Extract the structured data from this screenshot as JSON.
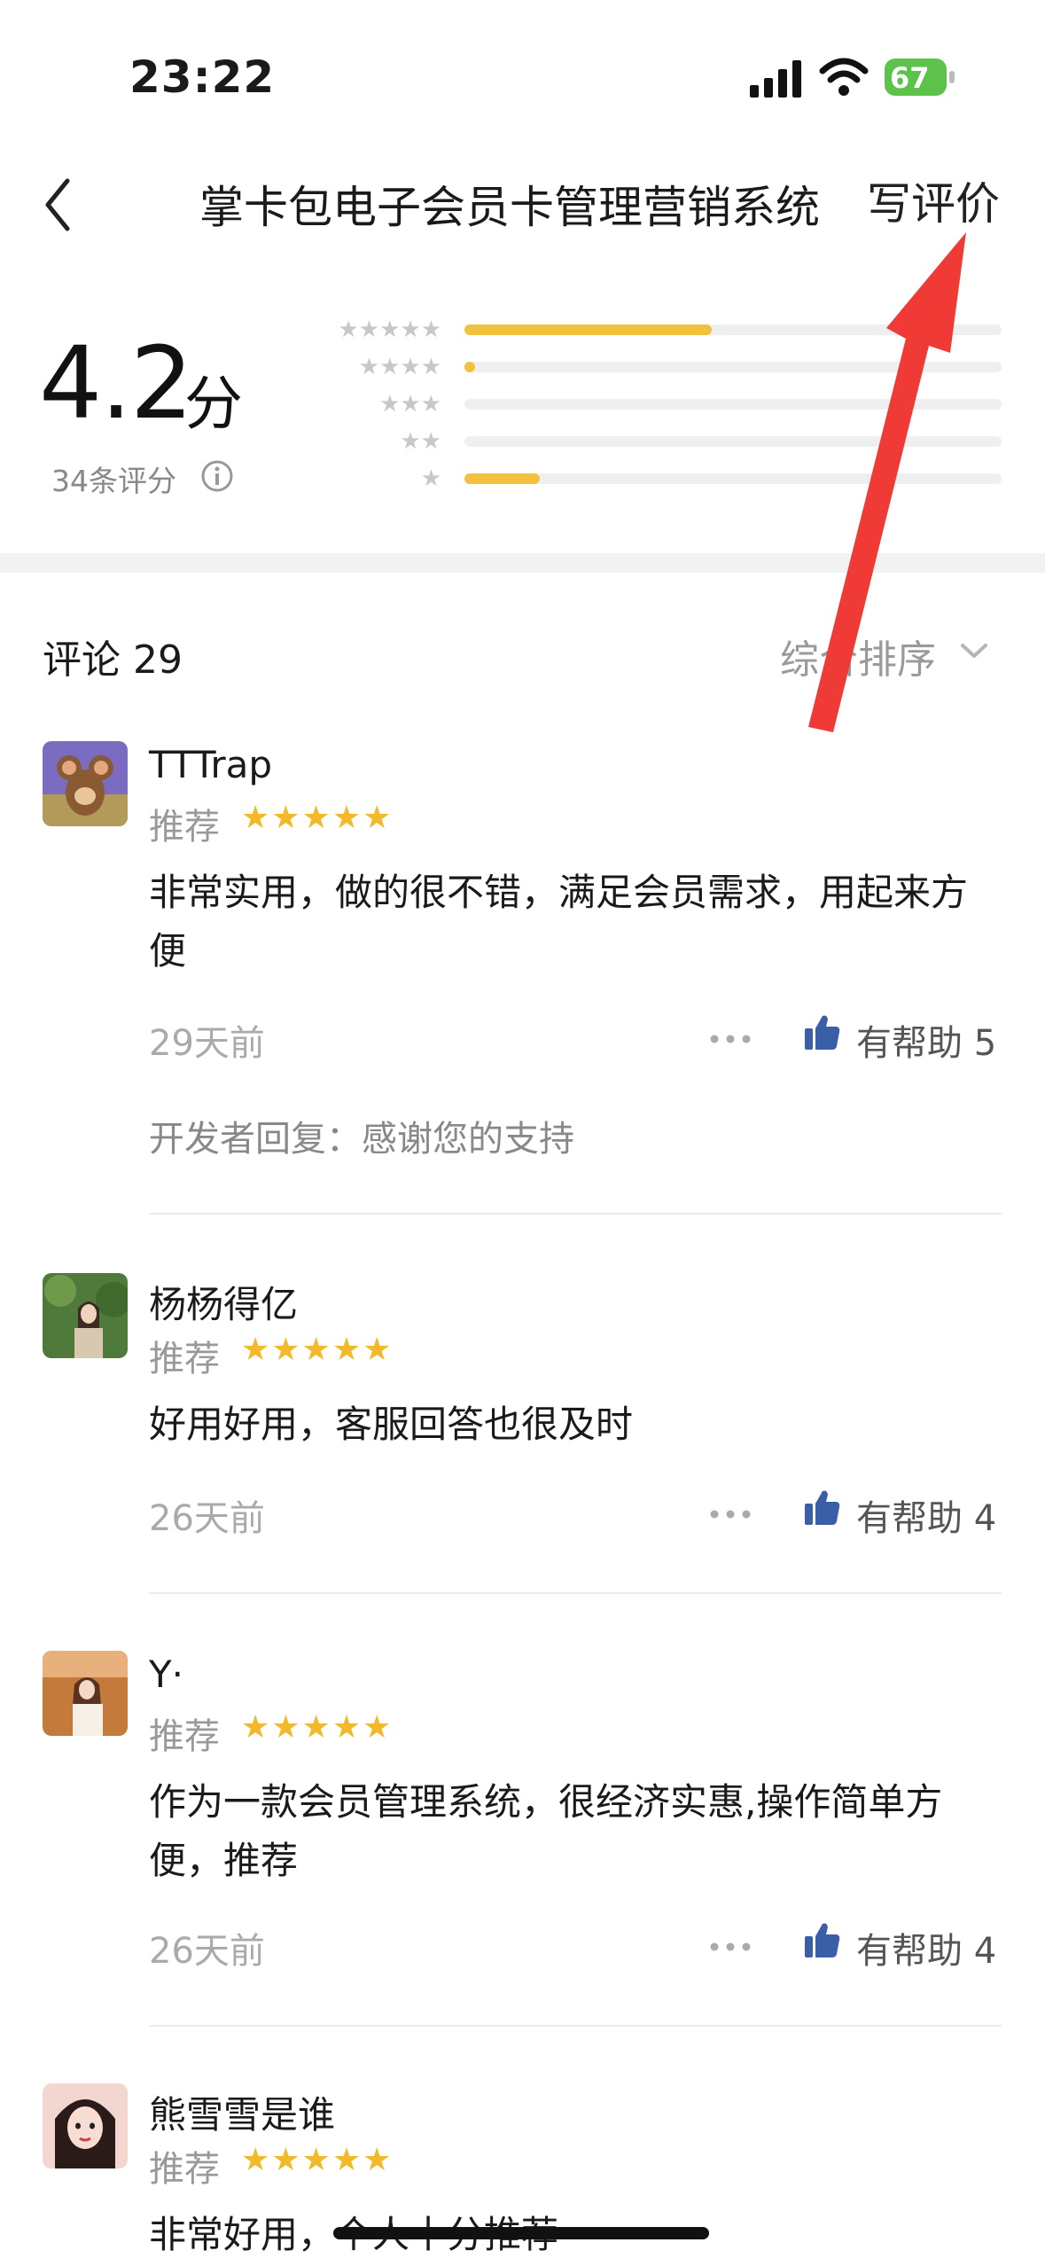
{
  "status_bar": {
    "time": "23:22",
    "battery": "67"
  },
  "nav": {
    "title": "掌卡包电子会员卡管理营销系统",
    "action": "写评价"
  },
  "rating": {
    "score": "4.2",
    "unit": "分",
    "count_label": "34条评分",
    "distribution": [
      {
        "stars": 5,
        "fraction": 0.46
      },
      {
        "stars": 4,
        "fraction": 0.02
      },
      {
        "stars": 3,
        "fraction": 0.0
      },
      {
        "stars": 2,
        "fraction": 0.0
      },
      {
        "stars": 1,
        "fraction": 0.14
      }
    ],
    "bar_color": "#f2c23f"
  },
  "comments": {
    "title": "评论 29",
    "sort": "综合排序"
  },
  "reviews": [
    {
      "user": "TTTrap",
      "recommend": "推荐",
      "stars": "★★★★★",
      "text": "非常实用，做的很不错，满足会员需求，用起来方便",
      "date": "29天前",
      "helpful": "有帮助 5",
      "reply": "开发者回复：感谢您的支持"
    },
    {
      "user": "杨杨得亿",
      "recommend": "推荐",
      "stars": "★★★★★",
      "text": "好用好用，客服回答也很及时",
      "date": "26天前",
      "helpful": "有帮助 4"
    },
    {
      "user": "Y·",
      "recommend": "推荐",
      "stars": "★★★★★",
      "text": "作为一款会员管理系统，很经济实惠,操作简单方便，推荐",
      "date": "26天前",
      "helpful": "有帮助 4"
    },
    {
      "user": "熊雪雪是谁",
      "recommend": "推荐",
      "stars": "★★★★★",
      "text": "非常好用，个人十分推荐"
    }
  ],
  "colors": {
    "star": "#f2b92a",
    "accent_thumb": "#3a5ea8",
    "annotation": "#f03a35"
  },
  "icons": [
    "back-icon",
    "info-icon",
    "chevron-down-icon",
    "more-icon",
    "thumbs-up-icon"
  ]
}
